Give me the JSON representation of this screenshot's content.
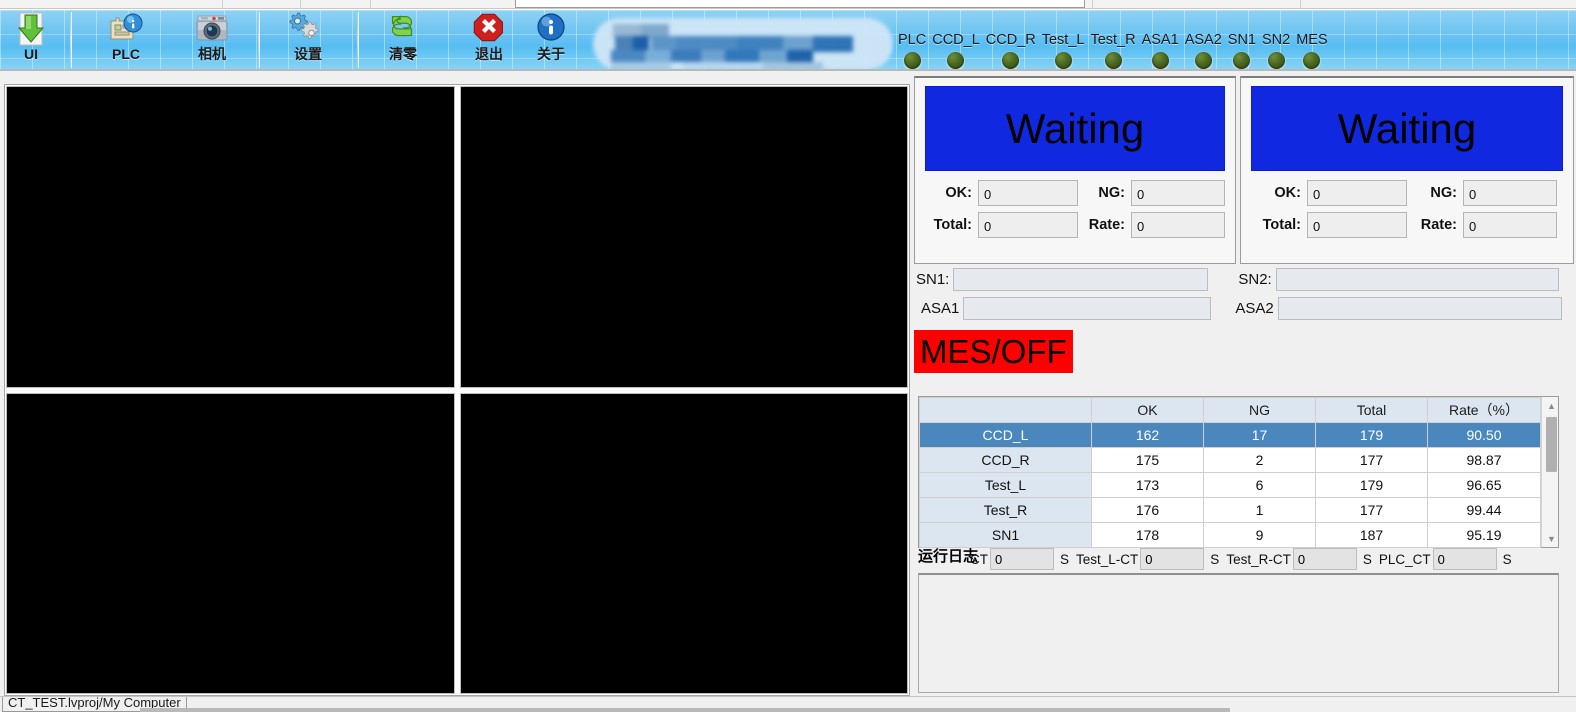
{
  "window": {
    "status_bar_text": "CT_TEST.lvproj/My Computer"
  },
  "toolbar": {
    "buttons": [
      {
        "label": "UI",
        "icon": "download-arrow-icon"
      },
      {
        "label": "PLC",
        "icon": "plc-card-info-icon"
      },
      {
        "label": "相机",
        "icon": "camera-icon"
      },
      {
        "label": "设置",
        "icon": "gears-settings-icon"
      },
      {
        "label": "清零",
        "icon": "refresh-reset-icon"
      },
      {
        "label": "退出",
        "icon": "close-exit-icon"
      },
      {
        "label": "关于",
        "icon": "info-about-icon"
      }
    ],
    "lamps": [
      {
        "label": "PLC",
        "color": "#4d6b23"
      },
      {
        "label": "CCD_L",
        "color": "#4d6b23"
      },
      {
        "label": "CCD_R",
        "color": "#4d6b23"
      },
      {
        "label": "Test_L",
        "color": "#4d6b23"
      },
      {
        "label": "Test_R",
        "color": "#4d6b23"
      },
      {
        "label": "ASA1",
        "color": "#4d6b23"
      },
      {
        "label": "ASA2",
        "color": "#4d6b23"
      },
      {
        "label": "SN1",
        "color": "#4d6b23"
      },
      {
        "label": "SN2",
        "color": "#4d6b23"
      },
      {
        "label": "MES",
        "color": "#4d6b23"
      }
    ]
  },
  "video": {
    "panels": [
      {
        "name": "video-panel-top-left"
      },
      {
        "name": "video-panel-top-right"
      },
      {
        "name": "video-panel-bottom-left"
      },
      {
        "name": "video-panel-bottom-right"
      }
    ]
  },
  "stations": [
    {
      "status": "Waiting",
      "status_color": "#1029e0",
      "ok_label": "OK:",
      "ok_value": "0",
      "ng_label": "NG:",
      "ng_value": "0",
      "total_label": "Total:",
      "total_value": "0",
      "rate_label": "Rate:",
      "rate_value": "0"
    },
    {
      "status": "Waiting",
      "status_color": "#1029e0",
      "ok_label": "OK:",
      "ok_value": "0",
      "ng_label": "NG:",
      "ng_value": "0",
      "total_label": "Total:",
      "total_value": "0",
      "rate_label": "Rate:",
      "rate_value": "0"
    }
  ],
  "sn_fields": {
    "sn1_label": "SN1:",
    "sn1_value": "",
    "sn2_label": "SN2:",
    "sn2_value": "",
    "asa1_label": "ASA1",
    "asa1_value": "",
    "asa2_label": "ASA2",
    "asa2_value": ""
  },
  "mes": {
    "label": "MES/OFF",
    "bg_color": "#ff0000"
  },
  "table": {
    "headers": [
      "",
      "OK",
      "NG",
      "Total",
      "Rate（%）"
    ],
    "rows": [
      {
        "name": "CCD_L",
        "ok": "162",
        "ng": "17",
        "total": "179",
        "rate": "90.50",
        "selected": true
      },
      {
        "name": "CCD_R",
        "ok": "175",
        "ng": "2",
        "total": "177",
        "rate": "98.87",
        "selected": false
      },
      {
        "name": "Test_L",
        "ok": "173",
        "ng": "6",
        "total": "179",
        "rate": "96.65",
        "selected": false
      },
      {
        "name": "Test_R",
        "ok": "176",
        "ng": "1",
        "total": "177",
        "rate": "99.44",
        "selected": false
      },
      {
        "name": "SN1",
        "ok": "178",
        "ng": "9",
        "total": "187",
        "rate": "95.19",
        "selected": false
      }
    ]
  },
  "ct_bar": {
    "runlog_label": "运行日志",
    "items": [
      {
        "label": "CT",
        "value": "0",
        "unit": "S"
      },
      {
        "label": "Test_L-CT",
        "value": "0",
        "unit": "S"
      },
      {
        "label": "Test_R-CT",
        "value": "0",
        "unit": "S"
      },
      {
        "label": "PLC_CT",
        "value": "0",
        "unit": "S"
      }
    ]
  },
  "log": {
    "content": ""
  }
}
